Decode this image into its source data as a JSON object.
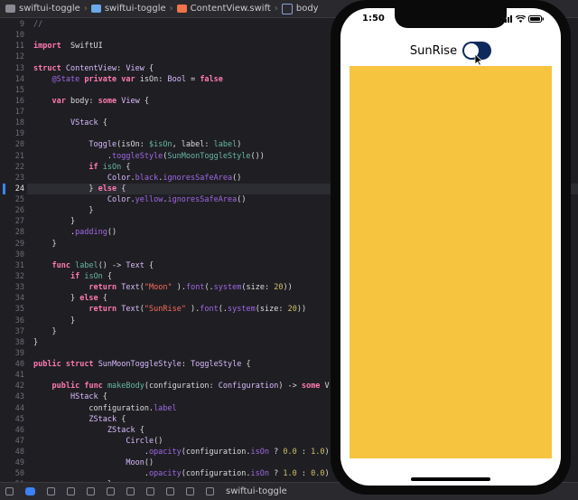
{
  "breadcrumb": [
    "swiftui-toggle",
    "swiftui-toggle",
    "ContentView.swift",
    "body"
  ],
  "current_line": 24,
  "code_lines": [
    {
      "n": 9,
      "tokens": [
        [
          "cm",
          "//"
        ]
      ]
    },
    {
      "n": 10,
      "tokens": []
    },
    {
      "n": 11,
      "tokens": [
        [
          "kw",
          "import"
        ],
        [
          "",
          "  "
        ],
        [
          "",
          "SwiftUI"
        ]
      ]
    },
    {
      "n": 12,
      "tokens": []
    },
    {
      "n": 13,
      "tokens": [
        [
          "kw",
          "struct"
        ],
        [
          "",
          " "
        ],
        [
          "ty",
          "ContentView"
        ],
        [
          "",
          ": "
        ],
        [
          "ty",
          "View"
        ],
        [
          "",
          " {"
        ]
      ]
    },
    {
      "n": 14,
      "tokens": [
        [
          "",
          "    "
        ],
        [
          "pr",
          "@State"
        ],
        [
          "",
          " "
        ],
        [
          "kw",
          "private"
        ],
        [
          "",
          " "
        ],
        [
          "kw",
          "var"
        ],
        [
          "",
          " isOn: "
        ],
        [
          "ty",
          "Bool"
        ],
        [
          "",
          " = "
        ],
        [
          "kw",
          "false"
        ]
      ]
    },
    {
      "n": 15,
      "tokens": []
    },
    {
      "n": 16,
      "tokens": [
        [
          "",
          "    "
        ],
        [
          "kw",
          "var"
        ],
        [
          "",
          " body: "
        ],
        [
          "kw",
          "some"
        ],
        [
          "",
          " "
        ],
        [
          "ty",
          "View"
        ],
        [
          "",
          " {"
        ]
      ]
    },
    {
      "n": 17,
      "tokens": []
    },
    {
      "n": 18,
      "tokens": [
        [
          "",
          "        "
        ],
        [
          "ty",
          "VStack"
        ],
        [
          "",
          " {"
        ]
      ]
    },
    {
      "n": 19,
      "tokens": []
    },
    {
      "n": 20,
      "tokens": [
        [
          "",
          "            "
        ],
        [
          "ty",
          "Toggle"
        ],
        [
          "",
          "(isOn: "
        ],
        [
          "fn",
          "$isOn"
        ],
        [
          "",
          ", label: "
        ],
        [
          "fn",
          "label"
        ],
        [
          "",
          ")"
        ]
      ]
    },
    {
      "n": 21,
      "tokens": [
        [
          "",
          "                ."
        ],
        [
          "pr",
          "toggleStyle"
        ],
        [
          "",
          "("
        ],
        [
          "fn",
          "SunMoonToggleStyle"
        ],
        [
          "",
          "())"
        ]
      ]
    },
    {
      "n": 22,
      "tokens": [
        [
          "",
          "            "
        ],
        [
          "kw",
          "if"
        ],
        [
          "",
          " "
        ],
        [
          "fn",
          "isOn"
        ],
        [
          "",
          " {"
        ]
      ]
    },
    {
      "n": 23,
      "tokens": [
        [
          "",
          "                "
        ],
        [
          "ty",
          "Color"
        ],
        [
          "",
          "."
        ],
        [
          "pr",
          "black"
        ],
        [
          "",
          "."
        ],
        [
          "pr",
          "ignoresSafeArea"
        ],
        [
          "",
          "()"
        ]
      ]
    },
    {
      "n": 24,
      "tokens": [
        [
          "",
          "            } "
        ],
        [
          "kw",
          "else"
        ],
        [
          "",
          " {"
        ]
      ]
    },
    {
      "n": 25,
      "tokens": [
        [
          "",
          "                "
        ],
        [
          "ty",
          "Color"
        ],
        [
          "",
          "."
        ],
        [
          "pr",
          "yellow"
        ],
        [
          "",
          "."
        ],
        [
          "pr",
          "ignoresSafeArea"
        ],
        [
          "",
          "()"
        ]
      ]
    },
    {
      "n": 26,
      "tokens": [
        [
          "",
          "            }"
        ]
      ]
    },
    {
      "n": 27,
      "tokens": [
        [
          "",
          "        }"
        ]
      ]
    },
    {
      "n": 28,
      "tokens": [
        [
          "",
          "        ."
        ],
        [
          "pr",
          "padding"
        ],
        [
          "",
          "()"
        ]
      ]
    },
    {
      "n": 29,
      "tokens": [
        [
          "",
          "    }"
        ]
      ]
    },
    {
      "n": 30,
      "tokens": []
    },
    {
      "n": 31,
      "tokens": [
        [
          "",
          "    "
        ],
        [
          "kw",
          "func"
        ],
        [
          "",
          " "
        ],
        [
          "fn",
          "label"
        ],
        [
          "",
          "() -> "
        ],
        [
          "ty",
          "Text"
        ],
        [
          "",
          " {"
        ]
      ]
    },
    {
      "n": 32,
      "tokens": [
        [
          "",
          "        "
        ],
        [
          "kw",
          "if"
        ],
        [
          "",
          " "
        ],
        [
          "fn",
          "isOn"
        ],
        [
          "",
          " {"
        ]
      ]
    },
    {
      "n": 33,
      "tokens": [
        [
          "",
          "            "
        ],
        [
          "kw",
          "return"
        ],
        [
          "",
          " "
        ],
        [
          "ty",
          "Text"
        ],
        [
          "",
          "("
        ],
        [
          "st",
          "\"Moon\""
        ],
        [
          "",
          " )."
        ],
        [
          "pr",
          "font"
        ],
        [
          "",
          "(."
        ],
        [
          "pr",
          "system"
        ],
        [
          "",
          "(size: "
        ],
        [
          "nu",
          "20"
        ],
        [
          "",
          "))"
        ]
      ]
    },
    {
      "n": 34,
      "tokens": [
        [
          "",
          "        } "
        ],
        [
          "kw",
          "else"
        ],
        [
          "",
          " {"
        ]
      ]
    },
    {
      "n": 35,
      "tokens": [
        [
          "",
          "            "
        ],
        [
          "kw",
          "return"
        ],
        [
          "",
          " "
        ],
        [
          "ty",
          "Text"
        ],
        [
          "",
          "("
        ],
        [
          "st",
          "\"SunRise\""
        ],
        [
          "",
          " )."
        ],
        [
          "pr",
          "font"
        ],
        [
          "",
          "(."
        ],
        [
          "pr",
          "system"
        ],
        [
          "",
          "(size: "
        ],
        [
          "nu",
          "20"
        ],
        [
          "",
          "))"
        ]
      ]
    },
    {
      "n": 36,
      "tokens": [
        [
          "",
          "        }"
        ]
      ]
    },
    {
      "n": 37,
      "tokens": [
        [
          "",
          "    }"
        ]
      ]
    },
    {
      "n": 38,
      "tokens": [
        [
          "",
          "}"
        ]
      ]
    },
    {
      "n": 39,
      "tokens": []
    },
    {
      "n": 40,
      "tokens": [
        [
          "kw",
          "public"
        ],
        [
          "",
          " "
        ],
        [
          "kw",
          "struct"
        ],
        [
          "",
          " "
        ],
        [
          "ty",
          "SunMoonToggleStyle"
        ],
        [
          "",
          ": "
        ],
        [
          "ty",
          "ToggleStyle"
        ],
        [
          "",
          " {"
        ]
      ]
    },
    {
      "n": 41,
      "tokens": []
    },
    {
      "n": 42,
      "tokens": [
        [
          "",
          "    "
        ],
        [
          "kw",
          "public"
        ],
        [
          "",
          " "
        ],
        [
          "kw",
          "func"
        ],
        [
          "",
          " "
        ],
        [
          "fn",
          "makeBody"
        ],
        [
          "",
          "(configuration: "
        ],
        [
          "ty",
          "Configuration"
        ],
        [
          "",
          ") -> "
        ],
        [
          "kw",
          "some"
        ],
        [
          "",
          " V:"
        ]
      ]
    },
    {
      "n": 43,
      "tokens": [
        [
          "",
          "        "
        ],
        [
          "ty",
          "HStack"
        ],
        [
          "",
          " {"
        ]
      ]
    },
    {
      "n": 44,
      "tokens": [
        [
          "",
          "            configuration."
        ],
        [
          "pr",
          "label"
        ]
      ]
    },
    {
      "n": 45,
      "tokens": [
        [
          "",
          "            "
        ],
        [
          "ty",
          "ZStack"
        ],
        [
          "",
          " {"
        ]
      ]
    },
    {
      "n": 46,
      "tokens": [
        [
          "",
          "                "
        ],
        [
          "ty",
          "ZStack"
        ],
        [
          "",
          " {"
        ]
      ]
    },
    {
      "n": 47,
      "tokens": [
        [
          "",
          "                    "
        ],
        [
          "ty",
          "Circle"
        ],
        [
          "",
          "()"
        ]
      ]
    },
    {
      "n": 48,
      "tokens": [
        [
          "",
          "                        ."
        ],
        [
          "pr",
          "opacity"
        ],
        [
          "",
          "(configuration."
        ],
        [
          "pr",
          "isOn"
        ],
        [
          "",
          " ? "
        ],
        [
          "nu",
          "0.0"
        ],
        [
          "",
          " : "
        ],
        [
          "nu",
          "1.0"
        ],
        [
          "",
          ")"
        ]
      ]
    },
    {
      "n": 49,
      "tokens": [
        [
          "",
          "                    "
        ],
        [
          "ty",
          "Moon"
        ],
        [
          "",
          "()"
        ]
      ]
    },
    {
      "n": 50,
      "tokens": [
        [
          "",
          "                        ."
        ],
        [
          "pr",
          "opacity"
        ],
        [
          "",
          "(configuration."
        ],
        [
          "pr",
          "isOn"
        ],
        [
          "",
          " ? "
        ],
        [
          "nu",
          "1.0"
        ],
        [
          "",
          " : "
        ],
        [
          "nu",
          "0.0"
        ],
        [
          "",
          ")"
        ]
      ]
    },
    {
      "n": 51,
      "tokens": [
        [
          "",
          "                }"
        ]
      ]
    }
  ],
  "toolbar": {
    "scheme_label": "swiftui-toggle"
  },
  "phone": {
    "time": "1:50",
    "toggle_label": "SunRise",
    "toggle_on": false,
    "background_color": "#f7c440"
  },
  "colors": {
    "accent": "#3b82f6",
    "toggle_track": "#0e2a5c"
  }
}
